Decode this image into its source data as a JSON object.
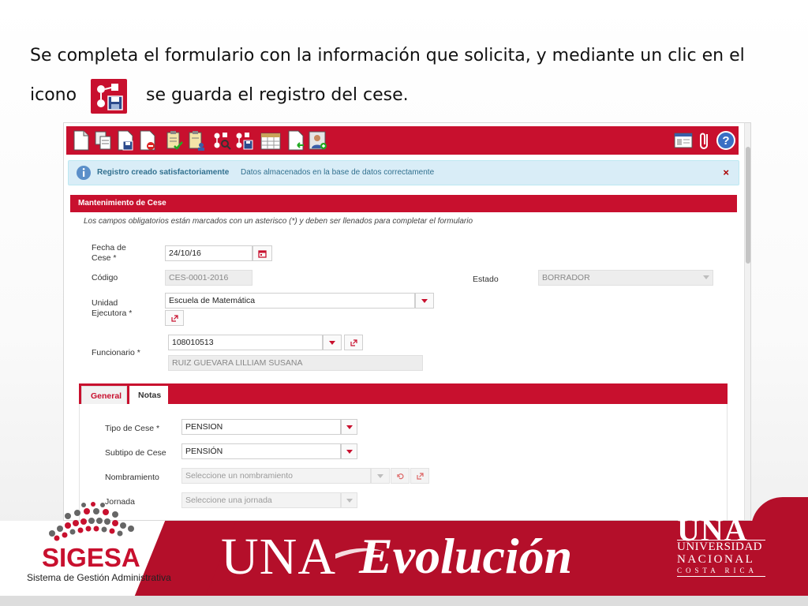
{
  "caption": {
    "line1": "Se completa el formulario con la información que solicita, y mediante un clic en el",
    "line2_prefix": "icono",
    "line2_suffix": "se guarda el registro del cese."
  },
  "toolbar": {
    "icons": [
      "new-document-icon",
      "copy-documents-icon",
      "save-document-icon",
      "delete-document-icon",
      "approve-checklist-icon",
      "checklist-user-icon",
      "workflow-search-icon",
      "workflow-save-icon",
      "calendar-sheet-icon",
      "document-import-icon",
      "user-add-icon"
    ],
    "right_icons": [
      "window-layout-icon",
      "paperclip-icon",
      "help-icon"
    ],
    "help_label": "?"
  },
  "alert": {
    "strong": "Registro creado satisfactoriamente",
    "message": "Datos almacenados en la base de datos correctamente",
    "close": "×"
  },
  "panel": {
    "title": "Mantenimiento de Cese",
    "note": "Los campos obligatorios están marcados con un asterisco (*) y deben ser llenados para completar el formulario"
  },
  "form": {
    "fecha_label_1": "Fecha de",
    "fecha_label_2": "Cese *",
    "fecha_value": "24/10/16",
    "codigo_label": "Código",
    "codigo_value": "CES-0001-2016",
    "estado_label": "Estado",
    "estado_value": "BORRADOR",
    "unidad_label_1": "Unidad",
    "unidad_label_2": "Ejecutora *",
    "unidad_value": "Escuela de Matemática",
    "funcionario_label": "Funcionario *",
    "funcionario_id": "108010513",
    "funcionario_name": "RUIZ  GUEVARA LILLIAM SUSANA"
  },
  "tabs": [
    {
      "label": "General",
      "active": true
    },
    {
      "label": "Notas",
      "active": false
    }
  ],
  "general": {
    "tipo_label": "Tipo de Cese *",
    "tipo_value": "PENSION",
    "subtipo_label": "Subtipo de Cese",
    "subtipo_value": "PENSIÓN",
    "nombramiento_label": "Nombramiento",
    "nombramiento_placeholder": "Seleccione un nombramiento",
    "jornada_label": "Jornada",
    "jornada_placeholder": "Seleccione una jornada"
  },
  "branding": {
    "sigesa": "SIGESA",
    "sigesa_sub": "Sistema de Gestión Administrativa",
    "una": "UNA",
    "evolucion": "Evolución",
    "logo_una": "UNA",
    "logo_l1": "UNIVERSIDAD",
    "logo_l2": "NACIONAL",
    "logo_l3": "COSTA RICA"
  },
  "colors": {
    "accent": "#c8102e",
    "info_bg": "#d9edf7",
    "info_text": "#31708f"
  }
}
